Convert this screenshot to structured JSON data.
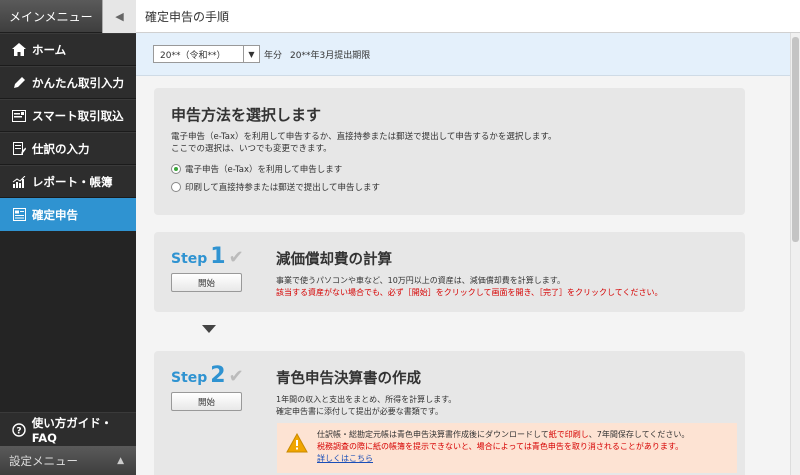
{
  "sidebar": {
    "menu_title": "メインメニュー",
    "items": [
      {
        "label": "ホーム",
        "icon": "home-icon"
      },
      {
        "label": "かんたん取引入力",
        "icon": "pencil-icon"
      },
      {
        "label": "スマート取引取込",
        "icon": "import-icon"
      },
      {
        "label": "仕訳の入力",
        "icon": "journal-icon"
      },
      {
        "label": "レポート・帳簿",
        "icon": "report-icon"
      },
      {
        "label": "確定申告",
        "icon": "tax-return-icon"
      }
    ],
    "help_label": "使い方ガイド・FAQ",
    "settings_label": "設定メニュー"
  },
  "header": {
    "title": "確定申告の手順"
  },
  "year_bar": {
    "selected_year": "20**（令和**）",
    "suffix": "年分",
    "deadline": "20**年3月提出期限"
  },
  "method": {
    "title": "申告方法を選択します",
    "desc1": "電子申告（e-Tax）を利用して申告するか、直接持参または郵送で提出して申告するかを選択します。",
    "desc2": "ここでの選択は、いつでも変更できます。",
    "option_etax": "電子申告（e-Tax）を利用して申告します",
    "option_print": "印刷して直接持参または郵送で提出して申告します"
  },
  "step1": {
    "word": "Step",
    "num": "1",
    "start_label": "開始",
    "title": "減価償却費の計算",
    "desc": "事業で使うパソコンや車など、10万円以上の資産は、減価償却費を計算します。",
    "note": "該当する資産がない場合でも、必ず［開始］をクリックして画面を開き、［完了］をクリックしてください。"
  },
  "step2": {
    "word": "Step",
    "num": "2",
    "start_label": "開始",
    "title": "青色申告決算書の作成",
    "desc1": "1年間の収入と支出をまとめ、所得を計算します。",
    "desc2": "確定申告書に添付して提出が必要な書類です。",
    "warn_line1_a": "仕訳帳・総勘定元帳は青色申告決算書作成後にダウンロードして",
    "warn_line1_b": "紙で印刷し",
    "warn_line1_c": "、7年間保存してください。",
    "warn_line2": "税務調査の際に紙の帳簿を提示できないと、場合によっては青色申告を取り消されることがあります。",
    "warn_link": "詳しくはこちら"
  },
  "colors": {
    "accent": "#2f93d1",
    "warning": "#d60000"
  }
}
